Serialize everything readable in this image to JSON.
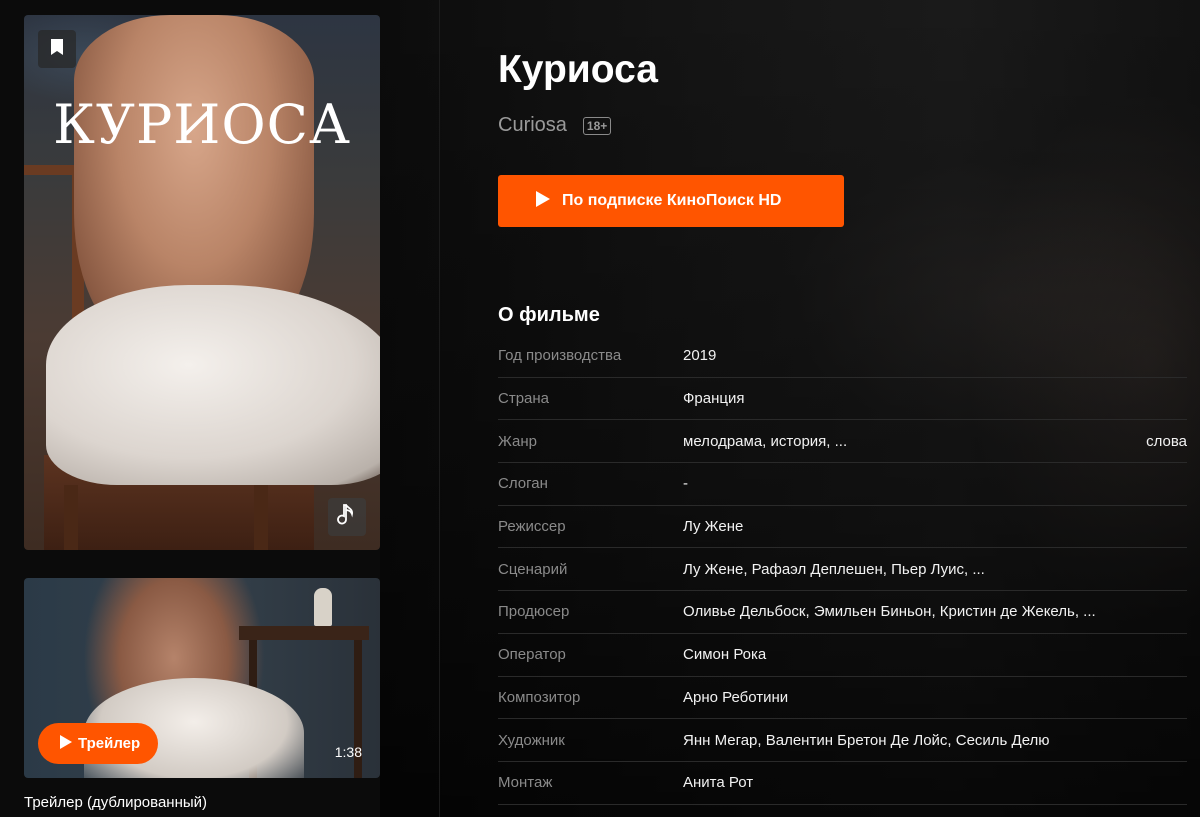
{
  "poster": {
    "title_text": "КУРИОСА",
    "bookmark_icon": "bookmark-icon",
    "music_icon": "music-note-icon"
  },
  "trailer": {
    "button_label": "Трейлер",
    "duration": "1:38",
    "caption": "Трейлер (дублированный)"
  },
  "film": {
    "title": "Куриоса",
    "original_title": "Curiosa",
    "age_rating": "18+",
    "watch_button_label": "По подписке КиноПоиск HD"
  },
  "about": {
    "section_title": "О фильме",
    "rows": [
      {
        "label": "Год производства",
        "value": "2019"
      },
      {
        "label": "Страна",
        "value": "Франция"
      },
      {
        "label": "Жанр",
        "value": "мелодрама, история, ...",
        "extra": "слова"
      },
      {
        "label": "Слоган",
        "value": "-"
      },
      {
        "label": "Режиссер",
        "value": "Лу Жене"
      },
      {
        "label": "Сценарий",
        "value": "Лу Жене, Рафаэл Деплешен, Пьер Луис, ..."
      },
      {
        "label": "Продюсер",
        "value": "Оливье Дельбоск, Эмильен Биньон, Кристин де Жекель, ..."
      },
      {
        "label": "Оператор",
        "value": "Симон Рока"
      },
      {
        "label": "Композитор",
        "value": "Арно Реботини"
      },
      {
        "label": "Художник",
        "value": "Янн Мегар, Валентин Бретон Де Лойс, Сесиль Делю"
      },
      {
        "label": "Монтаж",
        "value": "Анита Рот"
      }
    ]
  },
  "colors": {
    "accent": "#ff5500",
    "background": "#0b0b0b",
    "label_gray": "#8a8a8a"
  }
}
